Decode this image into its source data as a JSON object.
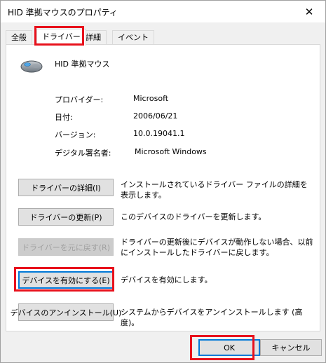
{
  "window": {
    "title": "HID 準拠マウスのプロパティ",
    "close_glyph": "✕"
  },
  "tabs": [
    {
      "label": "全般"
    },
    {
      "label": "ドライバー",
      "active": true
    },
    {
      "label": "詳細"
    },
    {
      "label": "イベント"
    }
  ],
  "device": {
    "name": "HID 準拠マウス",
    "icon": "mouse-icon"
  },
  "info": [
    {
      "label": "プロバイダー:",
      "value": "Microsoft"
    },
    {
      "label": "日付:",
      "value": "2006/06/21"
    },
    {
      "label": "バージョン:",
      "value": "10.0.19041.1"
    },
    {
      "label": "デジタル署名者:",
      "value": "Microsoft Windows"
    }
  ],
  "actions": [
    {
      "button": "ドライバーの詳細(I)",
      "description": "インストールされているドライバー ファイルの詳細を表示します。",
      "enabled": true
    },
    {
      "button": "ドライバーの更新(P)",
      "description": "このデバイスのドライバーを更新します。",
      "enabled": true
    },
    {
      "button": "ドライバーを元に戻す(R)",
      "description": "ドライバーの更新後にデバイスが動作しない場合、以前にインストールしたドライバーに戻します。",
      "enabled": false
    },
    {
      "button": "デバイスを有効にする(E)",
      "description": "デバイスを有効にします。",
      "enabled": true
    },
    {
      "button": "デバイスのアンインストール(U)",
      "description": "システムからデバイスをアンインストールします (高度)。",
      "enabled": true
    }
  ],
  "footer": {
    "ok_label": "OK",
    "cancel_label": "キャンセル"
  },
  "colors": {
    "highlight": "#e8111c",
    "focus": "#0078d7"
  }
}
